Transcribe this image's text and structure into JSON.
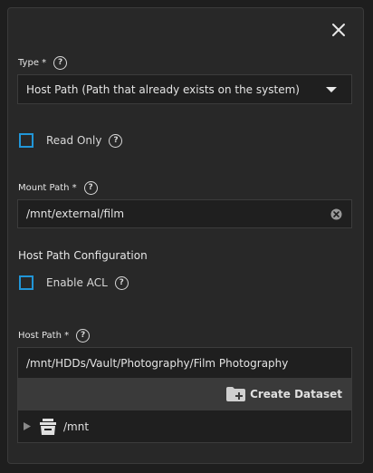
{
  "type_field": {
    "label": "Type *",
    "value": "Host Path (Path that already exists on the system)"
  },
  "read_only": {
    "label": "Read Only",
    "checked": false
  },
  "mount_path": {
    "label": "Mount Path *",
    "value": "/mnt/external/film"
  },
  "host_path_config": {
    "title": "Host Path Configuration"
  },
  "enable_acl": {
    "label": "Enable ACL",
    "checked": false
  },
  "host_path": {
    "label": "Host Path *",
    "value": "/mnt/HDDs/Vault/Photography/Film Photography",
    "create_dataset_label": "Create Dataset",
    "tree": [
      {
        "name": "/mnt",
        "expanded": false
      }
    ]
  },
  "icons": {
    "close": "close-icon",
    "help": "help-circle-icon",
    "dropdown": "caret-down-icon",
    "clear": "clear-circle-icon",
    "folder_add": "folder-plus-icon",
    "expand": "caret-right-icon",
    "pool": "storage-pool-icon"
  },
  "colors": {
    "accent": "#2196d8",
    "background": "#282828",
    "input": "#1f1f1f"
  }
}
